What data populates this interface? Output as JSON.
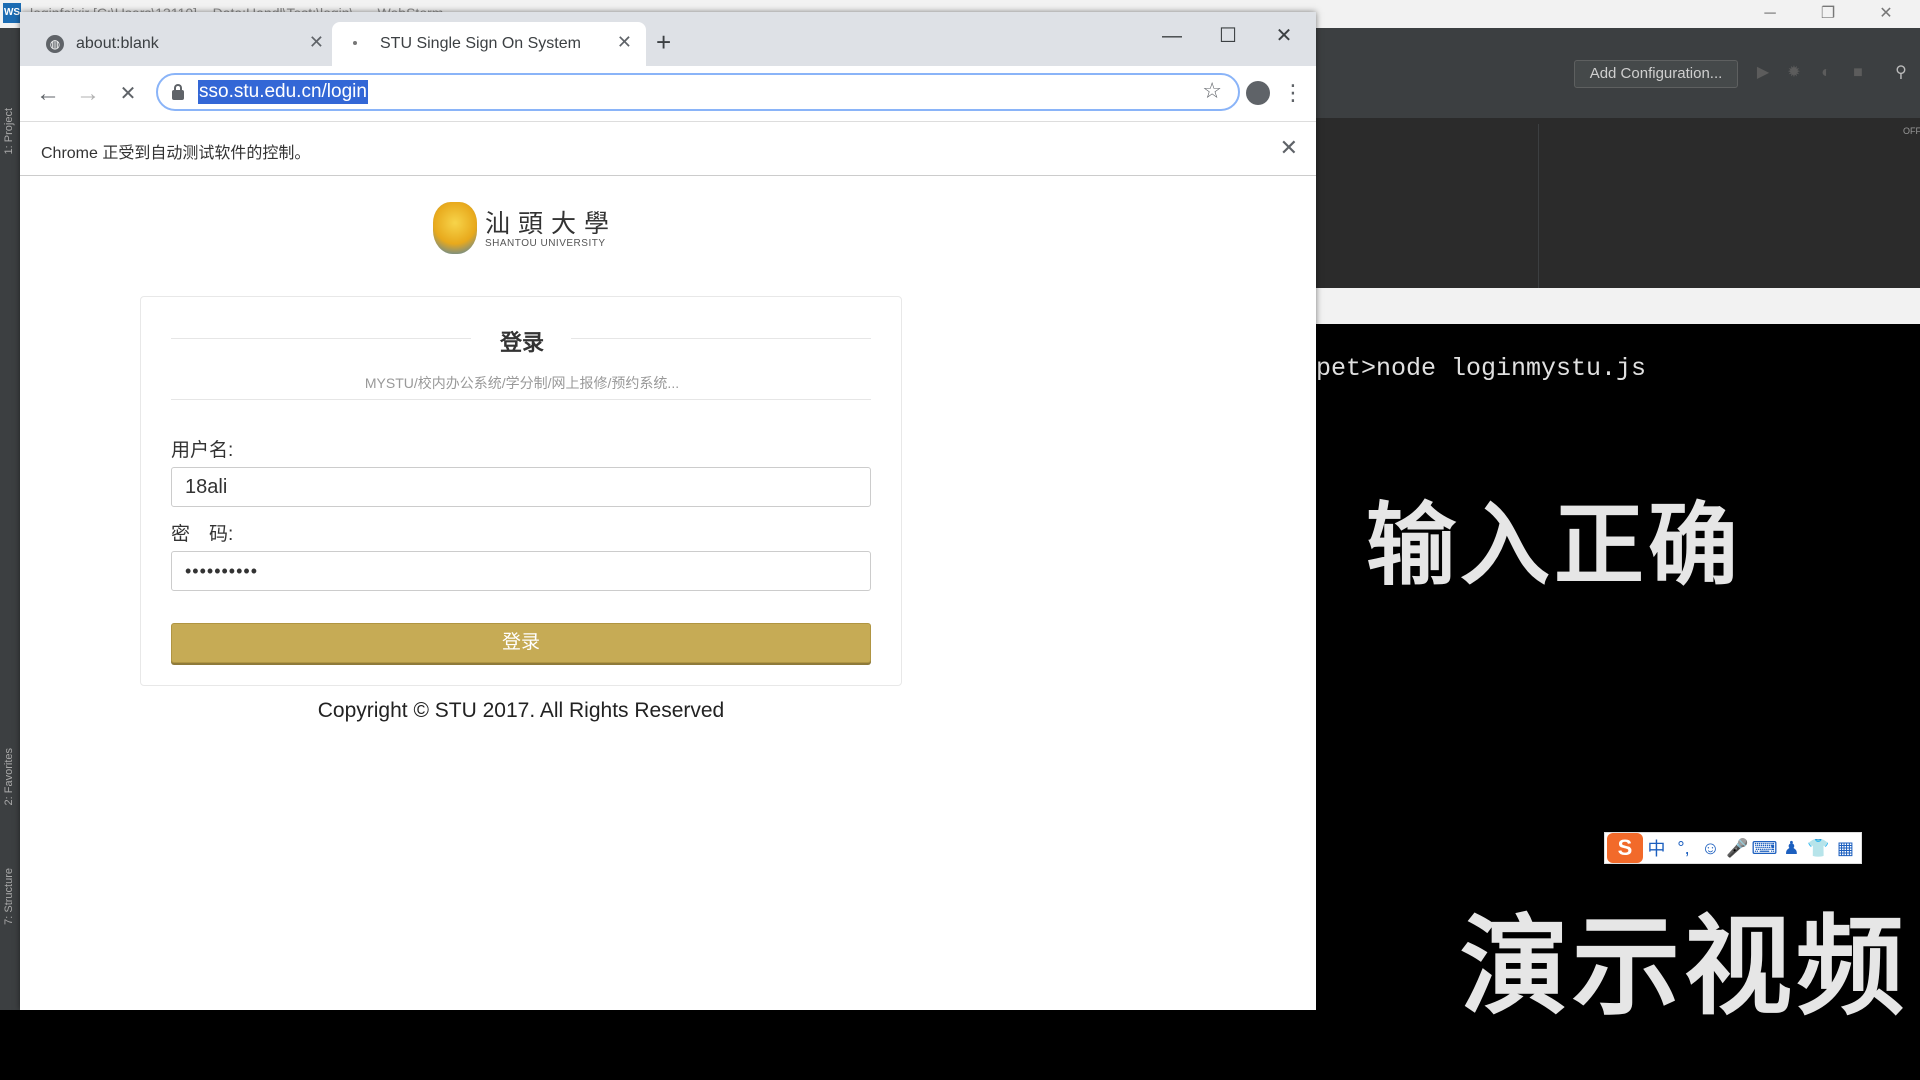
{
  "ide": {
    "title": "loginfaixir [C:\\Users\\13110] ...Data:Handl\\Test:\\login\\... - WebStorm",
    "app_icon": "WS",
    "add_configuration": "Add Configuration...",
    "left_tabs": {
      "project": "1: Project",
      "favorites": "2: Favorites",
      "structure": "7: Structure"
    },
    "off_label": "OFF",
    "window_controls": {
      "minimize": "─",
      "restore": "❐",
      "close": "✕"
    }
  },
  "terminal": {
    "command_line": "pet>node loginmystu.js",
    "overlay_top": "输入正确",
    "overlay_bottom": "演示视频"
  },
  "ime": {
    "logo": "S",
    "items": [
      "中",
      "°,",
      "☺",
      "🎤",
      "⌨",
      "♟",
      "👕",
      "▦"
    ]
  },
  "chrome": {
    "tabs": [
      {
        "title": "about:blank",
        "icon": "globe-icon"
      },
      {
        "title": "STU Single Sign On System",
        "icon": "loading-icon"
      }
    ],
    "new_tab": "+",
    "window_controls": {
      "minimize": "—",
      "maximize": "☐",
      "close": "✕"
    },
    "nav": {
      "back": "←",
      "forward": "→",
      "stop": "✕"
    },
    "url": "sso.stu.edu.cn/login",
    "bookmark_star": "☆",
    "menu": "⋮",
    "infobar_text": "Chrome 正受到自动测试软件的控制。",
    "infobar_close": "✕"
  },
  "page": {
    "logo_cn": "汕頭大學",
    "logo_en": "SHANTOU UNIVERSITY",
    "heading": "登录",
    "subtitle": "MYSTU/校内办公系统/学分制/网上报修/预约系统...",
    "username_label": "用户名:",
    "username_value": "18ali",
    "password_label": "密　码:",
    "password_value": "••••••••••",
    "login_button": "登录",
    "copyright": "Copyright © STU 2017. All Rights Reserved"
  },
  "colors": {
    "login_button": "#c6ab55",
    "url_highlight": "#3367d6",
    "ide_background": "#2b2b2b"
  }
}
